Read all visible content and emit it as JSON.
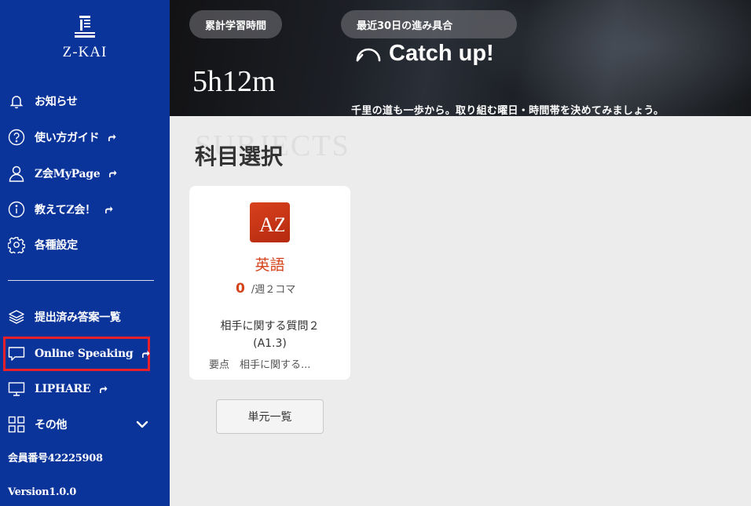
{
  "sidebar": {
    "logo_text": "Z-KAI",
    "items": [
      {
        "label": "お知らせ",
        "icon": "bell-icon"
      },
      {
        "label": "使い方ガイド",
        "icon": "help-circle-icon",
        "external": true
      },
      {
        "label": "Z会MyPage",
        "icon": "user-icon",
        "external": true
      },
      {
        "label": "教えてZ会！",
        "icon": "info-circle-icon",
        "external": true
      },
      {
        "label": "各種設定",
        "icon": "gear-icon"
      },
      {
        "label": "提出済み答案一覧",
        "icon": "layers-icon"
      },
      {
        "label": "Online Speaking",
        "icon": "chat-bubble-icon",
        "external": true,
        "highlighted": true
      },
      {
        "label": "LIPHARE",
        "icon": "monitor-icon",
        "external": true
      },
      {
        "label": "その他",
        "icon": "grid-icon",
        "expandable": true
      }
    ],
    "member_number": "会員番号42225908",
    "version": "Version1.0.0"
  },
  "hero": {
    "total_label": "累計学習時間",
    "total_value": "5h12m",
    "recent_label": "最近30日の進み具合",
    "status": "Catch up!",
    "message": "千里の道も一歩から。取り組む曜日・時間帯を決めてみましょう。"
  },
  "main": {
    "bg_label": "SUBJECTS",
    "section_title": "科目選択",
    "card": {
      "icon_text": "AZ",
      "subject": "英語",
      "progress_count": "0",
      "progress_unit": "/週２コマ",
      "lesson_title_1": "相手に関する質問２",
      "lesson_title_2": "(A1.3)",
      "lesson_sub": "要点　相手に関する..."
    },
    "unit_list_button": "単元一覧"
  },
  "colors": {
    "sidebar_bg": "#0b349a",
    "accent": "#d5431a",
    "highlight_border": "#e8202a"
  }
}
